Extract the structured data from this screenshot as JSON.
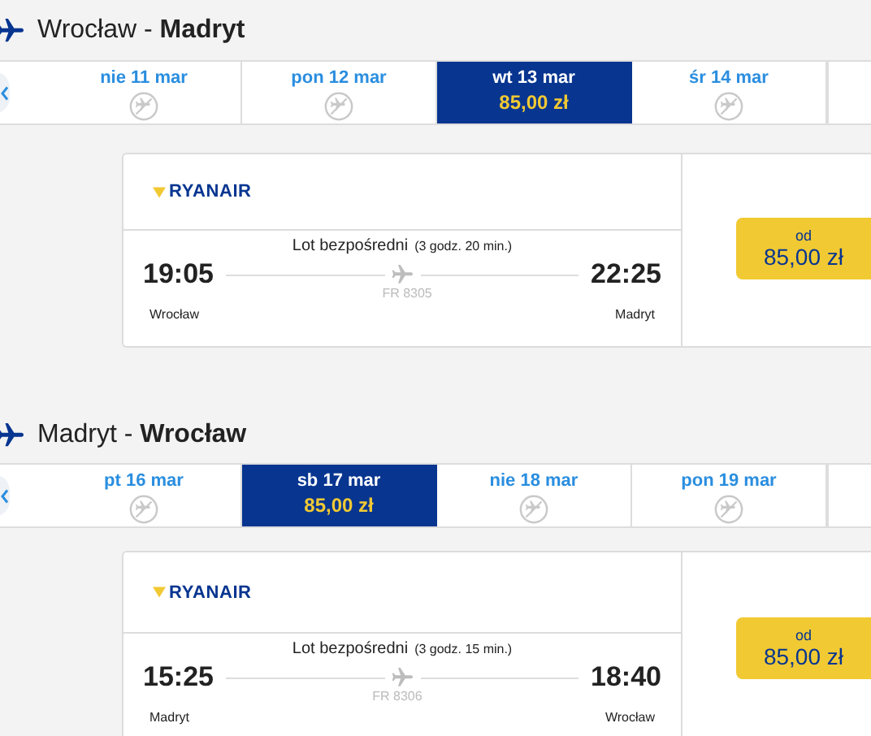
{
  "routes": [
    {
      "title": "Wrocław - **Madryt**",
      "dates": [
        {
          "label": "nie 11 mar",
          "selected": false
        },
        {
          "label": "pon 12 mar",
          "selected": false
        },
        {
          "label": "wt 13 mar",
          "price": "85,00 zł",
          "selected": true
        },
        {
          "label": "śr 14 mar",
          "selected": false
        }
      ],
      "flight": {
        "airline": "RYANAIR",
        "direct": "Lot bezpośredni",
        "duration": "(3 godz. 20 min.)",
        "dep_time": "19:05",
        "arr_time": "22:25",
        "flight_no": "FR 8305",
        "dep_city": "Wrocław",
        "arr_city": "Madryt"
      },
      "price": {
        "prefix": "od",
        "amount": "85,00 zł"
      }
    },
    {
      "title": "Madryt - **Wrocław**",
      "dates": [
        {
          "label": "pt 16 mar",
          "selected": false
        },
        {
          "label": "sb 17 mar",
          "price": "85,00 zł",
          "selected": true
        },
        {
          "label": "nie 18 mar",
          "selected": false
        },
        {
          "label": "pon 19 mar",
          "selected": false
        }
      ],
      "flight": {
        "airline": "RYANAIR",
        "direct": "Lot bezpośredni",
        "duration": "(3 godz. 15 min.)",
        "dep_time": "15:25",
        "arr_time": "18:40",
        "flight_no": "FR 8306",
        "dep_city": "Madryt",
        "arr_city": "Wrocław"
      },
      "price": {
        "prefix": "od",
        "amount": "85,00 zł"
      }
    }
  ]
}
